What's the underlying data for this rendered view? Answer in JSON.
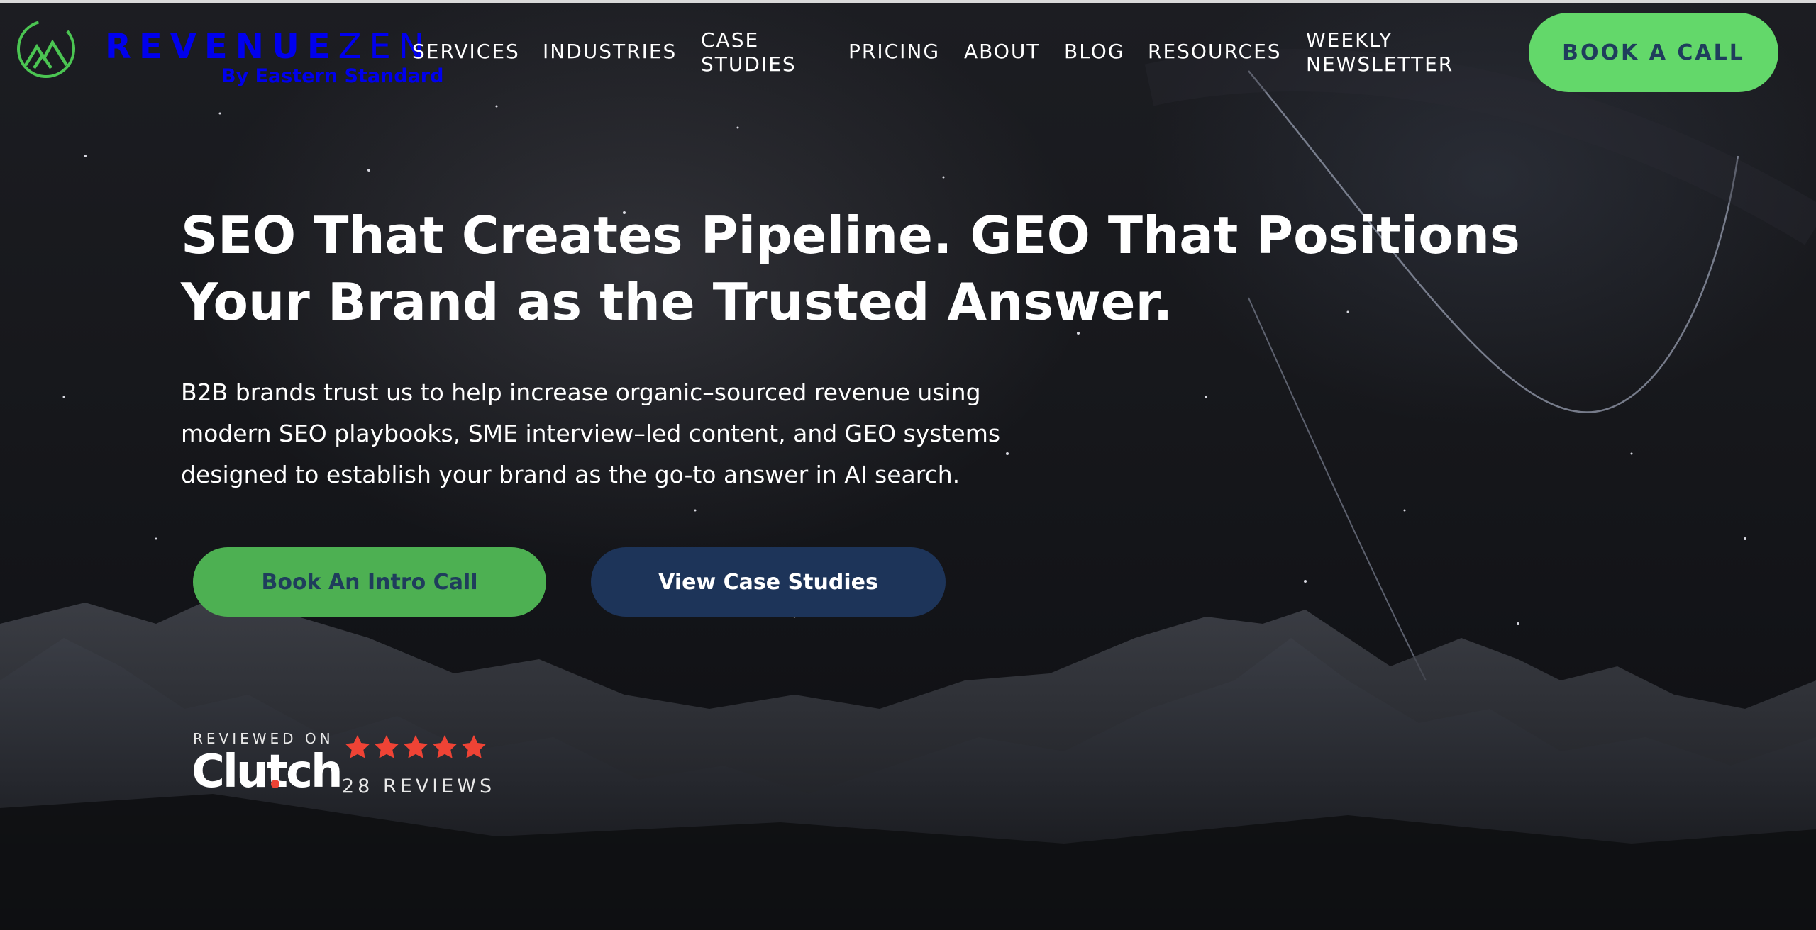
{
  "header": {
    "logo": {
      "word_bold": "REVENUE",
      "word_light": "ZEN",
      "tagline": "By Eastern Standard"
    },
    "nav": [
      {
        "label": "SERVICES"
      },
      {
        "label": "INDUSTRIES"
      },
      {
        "label": "CASE",
        "label2": "STUDIES"
      },
      {
        "label": "PRICING"
      },
      {
        "label": "ABOUT"
      },
      {
        "label": "BLOG"
      },
      {
        "label": "RESOURCES"
      },
      {
        "label": "WEEKLY",
        "label2": "NEWSLETTER"
      }
    ],
    "cta_label": "BOOK A CALL"
  },
  "hero": {
    "title_line1": "SEO That Creates Pipeline. GEO That Positions",
    "title_line2": "Your Brand as the Trusted Answer.",
    "subtitle_line1": "B2B brands trust us to help increase organic–sourced revenue using",
    "subtitle_line2": "modern SEO playbooks, SME interview–led content, and GEO systems",
    "subtitle_line3": "designed to establish your brand as the go-to answer in AI search.",
    "primary_button": "Book An Intro Call",
    "secondary_button": "View Case Studies"
  },
  "clutch": {
    "reviewed_on": "REVIEWED ON",
    "brand": "Clutch",
    "rating": 5,
    "reviews": "28 REVIEWS"
  },
  "colors": {
    "accent_green": "#63d86a",
    "button_green": "#4db052",
    "navy": "#1d3459",
    "text_navy": "#1f3d5c",
    "star_red": "#ef4335"
  },
  "icons": [
    "mountain-logo-icon",
    "star-icon"
  ]
}
